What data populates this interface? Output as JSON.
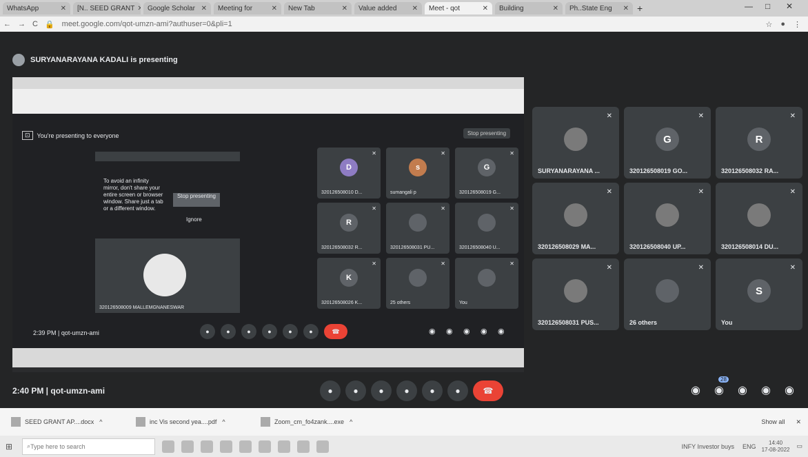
{
  "browser": {
    "tabs": [
      "WhatsApp",
      "[N.. SEED GRANT",
      "Google Scholar",
      "Meeting for",
      "New Tab",
      "Value added",
      "Meet - qot",
      "Building",
      "Ph..State Eng"
    ],
    "active_tab": 6,
    "url": "meet.google.com/qot-umzn-ami?authuser=0&pli=1"
  },
  "meet": {
    "presenter_text": "SURYANARAYANA KADALI is presenting",
    "time_code": "2:40 PM  |  qot-umzn-ami",
    "inner": {
      "presenting_text": "You're presenting to everyone",
      "stop_label": "Stop presenting",
      "warning": "To avoid an infinity mirror, don't share your entire screen or browser window. Share just a tab or a different window.",
      "stop2": "Stop presenting",
      "ignore": "Ignore",
      "pin_label": "320126508009 MALLEMGNANESWAR",
      "time_code": "2:39 PM  |  qot-umzn-ami",
      "tiles": [
        {
          "label": "320126508010 D...",
          "letter": "D",
          "color": "#8e7cc3"
        },
        {
          "label": "sumangali p",
          "letter": "s",
          "color": "#c27c4e"
        },
        {
          "label": "320126508019 G...",
          "letter": "G",
          "color": "#5f6368"
        },
        {
          "label": "320126508032 R...",
          "letter": "R",
          "color": "#5f6368"
        },
        {
          "label": "320126508031 PU...",
          "letter": "",
          "color": "#5f6368"
        },
        {
          "label": "320126508040 U...",
          "letter": "",
          "color": "#5f6368"
        },
        {
          "label": "320126508026 K...",
          "letter": "K",
          "color": "#5f6368"
        },
        {
          "label": "25 others",
          "letter": "",
          "color": "#5f6368"
        },
        {
          "label": "You",
          "letter": "",
          "color": "#5f6368"
        }
      ]
    },
    "right_tiles": [
      {
        "label": "SURYANARAYANA ...",
        "letter": "",
        "color": "#7a7a7a"
      },
      {
        "label": "320126508019 GO...",
        "letter": "G",
        "color": "#5f6368"
      },
      {
        "label": "320126508032 RA...",
        "letter": "R",
        "color": "#5f6368"
      },
      {
        "label": "320126508029 MA...",
        "letter": "",
        "color": "#7a7a7a"
      },
      {
        "label": "320126508040 UP...",
        "letter": "",
        "color": "#7a7a7a"
      },
      {
        "label": "320126508014 DU...",
        "letter": "",
        "color": "#7a7a7a"
      },
      {
        "label": "320126508031 PUS...",
        "letter": "",
        "color": "#7a7a7a"
      },
      {
        "label": "26 others",
        "letter": "",
        "color": "#5f6368"
      },
      {
        "label": "You",
        "letter": "S",
        "color": "#5f6368"
      }
    ],
    "participant_badge": "28"
  },
  "downloads": {
    "items": [
      "SEED GRANT AP....docx",
      "inc Vis second yea....pdf",
      "Zoom_cm_fo4zank....exe"
    ],
    "show_all": "Show all"
  },
  "taskbar": {
    "search_placeholder": "Type here to search",
    "news": "INFY  Investor buys",
    "lang": "ENG",
    "time": "14:40",
    "date": "17-08-2022"
  }
}
